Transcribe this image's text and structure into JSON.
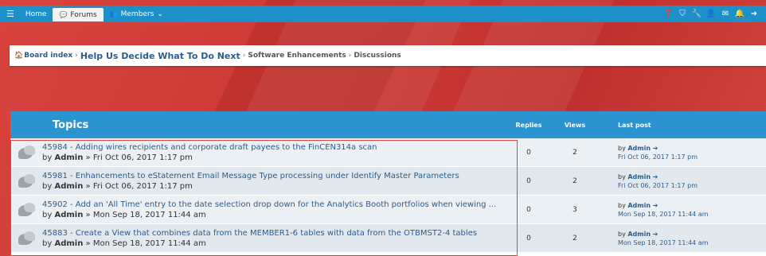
{
  "nav": {
    "menu_icon": "hamburger-icon",
    "home_label": "Home",
    "forums_label": "Forums",
    "members_label": "Members",
    "members_caret": "⌄",
    "right_icons": [
      "help-icon",
      "shield-icon",
      "wrench-icon",
      "user-icon",
      "messages-icon",
      "notifications-icon",
      "logout-icon"
    ]
  },
  "breadcrumb": {
    "items": [
      "Board index",
      "Help Us Decide What To Do Next",
      "Software Enhancements",
      "Discussions"
    ],
    "separator": "›"
  },
  "table": {
    "header": {
      "topics": "Topics",
      "replies": "Replies",
      "views": "Views",
      "last_post": "Last post"
    },
    "rows": [
      {
        "title": "45984 - Adding wires recipients and corporate draft payees to the FinCEN314a scan",
        "by_prefix": "by",
        "author": "Admin",
        "date_sep": "»",
        "date": "Fri Oct 06, 2017 1:17 pm",
        "replies": "0",
        "views": "2",
        "last_by": "by",
        "last_author": "Admin",
        "last_arrow": "➔",
        "last_date": "Fri Oct 06, 2017 1:17 pm"
      },
      {
        "title": "45981 - Enhancements to eStatement Email Message Type processing under Identify Master Parameters",
        "by_prefix": "by",
        "author": "Admin",
        "date_sep": "»",
        "date": "Fri Oct 06, 2017 1:17 pm",
        "replies": "0",
        "views": "2",
        "last_by": "by",
        "last_author": "Admin",
        "last_arrow": "➔",
        "last_date": "Fri Oct 06, 2017 1:17 pm"
      },
      {
        "title": "45902 - Add an 'All Time' entry to the date selection drop down for the Analytics Booth portfolios when viewing ...",
        "by_prefix": "by",
        "author": "Admin",
        "date_sep": "»",
        "date": "Mon Sep 18, 2017 11:44 am",
        "replies": "0",
        "views": "3",
        "last_by": "by",
        "last_author": "Admin",
        "last_arrow": "➔",
        "last_date": "Mon Sep 18, 2017 11:44 am"
      },
      {
        "title": "45883 - Create a View that combines data from the MEMBER1-6 tables with data from the OTBMST2-4 tables",
        "by_prefix": "by",
        "author": "Admin",
        "date_sep": "»",
        "date": "Mon Sep 18, 2017 11:44 am",
        "replies": "0",
        "views": "2",
        "last_by": "by",
        "last_author": "Admin",
        "last_arrow": "➔",
        "last_date": "Mon Sep 18, 2017 11:44 am"
      }
    ]
  },
  "colors": {
    "navbar": "#1d8fc9",
    "table_header": "#2a93d0",
    "link": "#2a5d8f",
    "background_red": "#c83a36",
    "highlight_border": "#e04040"
  }
}
